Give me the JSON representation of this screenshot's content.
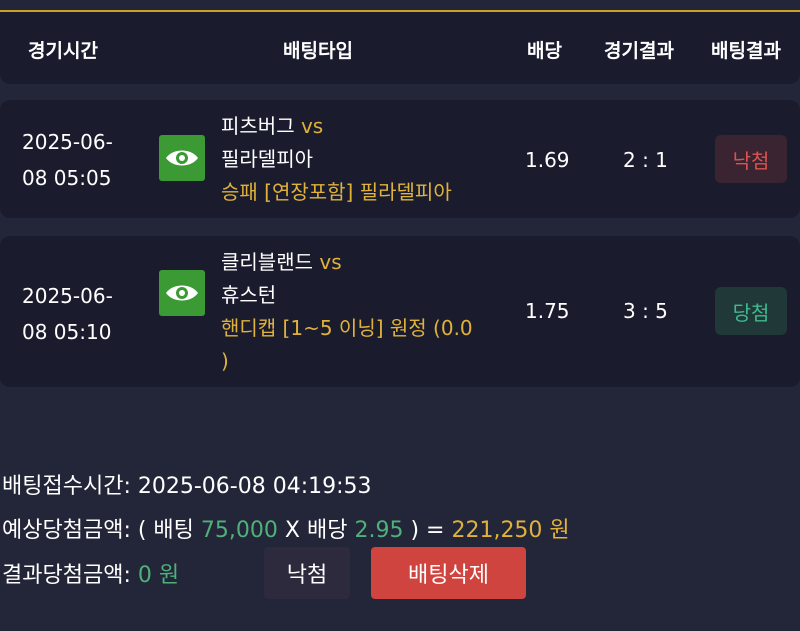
{
  "header": {
    "time": "경기시간",
    "bet_type": "배팅타입",
    "odds": "배당",
    "game_result": "경기결과",
    "bet_result": "배팅결과"
  },
  "rows": [
    {
      "time_line1": "2025-06-",
      "time_line2": "08 05:05",
      "home": "피츠버그",
      "vs": "vs",
      "away": "필라델피아",
      "bet_type": "승패 [연장포함] 필라델피아",
      "odds": "1.69",
      "score": "2 : 1",
      "result": "낙첨"
    },
    {
      "time_line1": "2025-06-",
      "time_line2": "08 05:10",
      "home": "클리블랜드",
      "vs": "vs",
      "away": "휴스턴",
      "bet_type": "핸디캡 [1~5 이닝] 원정 (0.0",
      "bet_type_cont": ")",
      "odds": "1.75",
      "score": "3 : 5",
      "result": "당첨"
    }
  ],
  "summary": {
    "bet_time_label": "배팅접수시간:",
    "bet_time_value": "2025-06-08 04:19:53",
    "expected_label": "예상당첨금액:",
    "open_paren": "( 배팅",
    "bet_amount": "75,000",
    "x_label": "X 배당",
    "total_odds": "2.95",
    "close_eq": ") =",
    "expected_amount": "221,250 원",
    "result_label": "결과당첨금액:",
    "result_amount": "0 원"
  },
  "buttons": {
    "result": "낙첨",
    "delete": "배팅삭제"
  },
  "colors": {
    "accent": "#e0b23a",
    "win": "#3fb98f",
    "lose": "#d9534f",
    "delete_button": "#d0443f"
  }
}
